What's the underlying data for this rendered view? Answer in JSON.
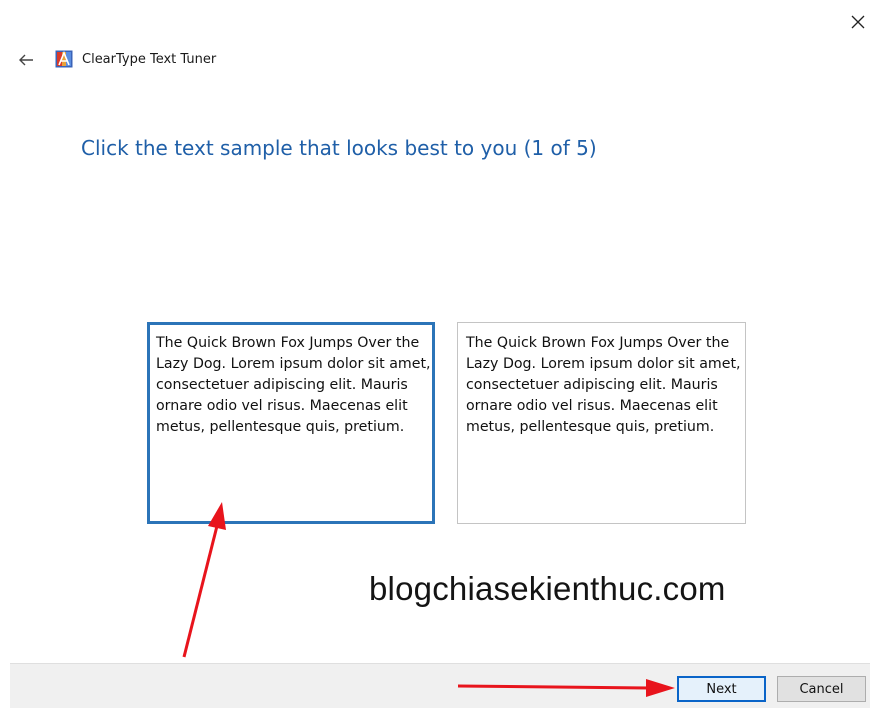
{
  "window": {
    "title": "ClearType Text Tuner",
    "close_icon": "close-icon",
    "back_icon": "back-arrow-icon",
    "app_icon": "cleartype-app-icon"
  },
  "main": {
    "heading": "Click the text sample that looks best to you (1 of 5)",
    "samples": [
      {
        "text": "The Quick Brown Fox Jumps Over the Lazy Dog. Lorem ipsum dolor sit amet, consectetuer adipiscing elit. Mauris ornare odio vel risus. Maecenas elit metus, pellentesque quis, pretium.",
        "selected": true
      },
      {
        "text": "The Quick Brown Fox Jumps Over the Lazy Dog. Lorem ipsum dolor sit amet, consectetuer adipiscing elit. Mauris ornare odio vel risus. Maecenas elit metus, pellentesque quis, pretium.",
        "selected": false
      }
    ]
  },
  "watermark": "blogchiasekienthuc.com",
  "footer": {
    "next_label": "Next",
    "cancel_label": "Cancel"
  },
  "colors": {
    "accent": "#1f5fa8",
    "selection_border": "#2b74b8",
    "annotation_arrow": "#e8141c"
  }
}
